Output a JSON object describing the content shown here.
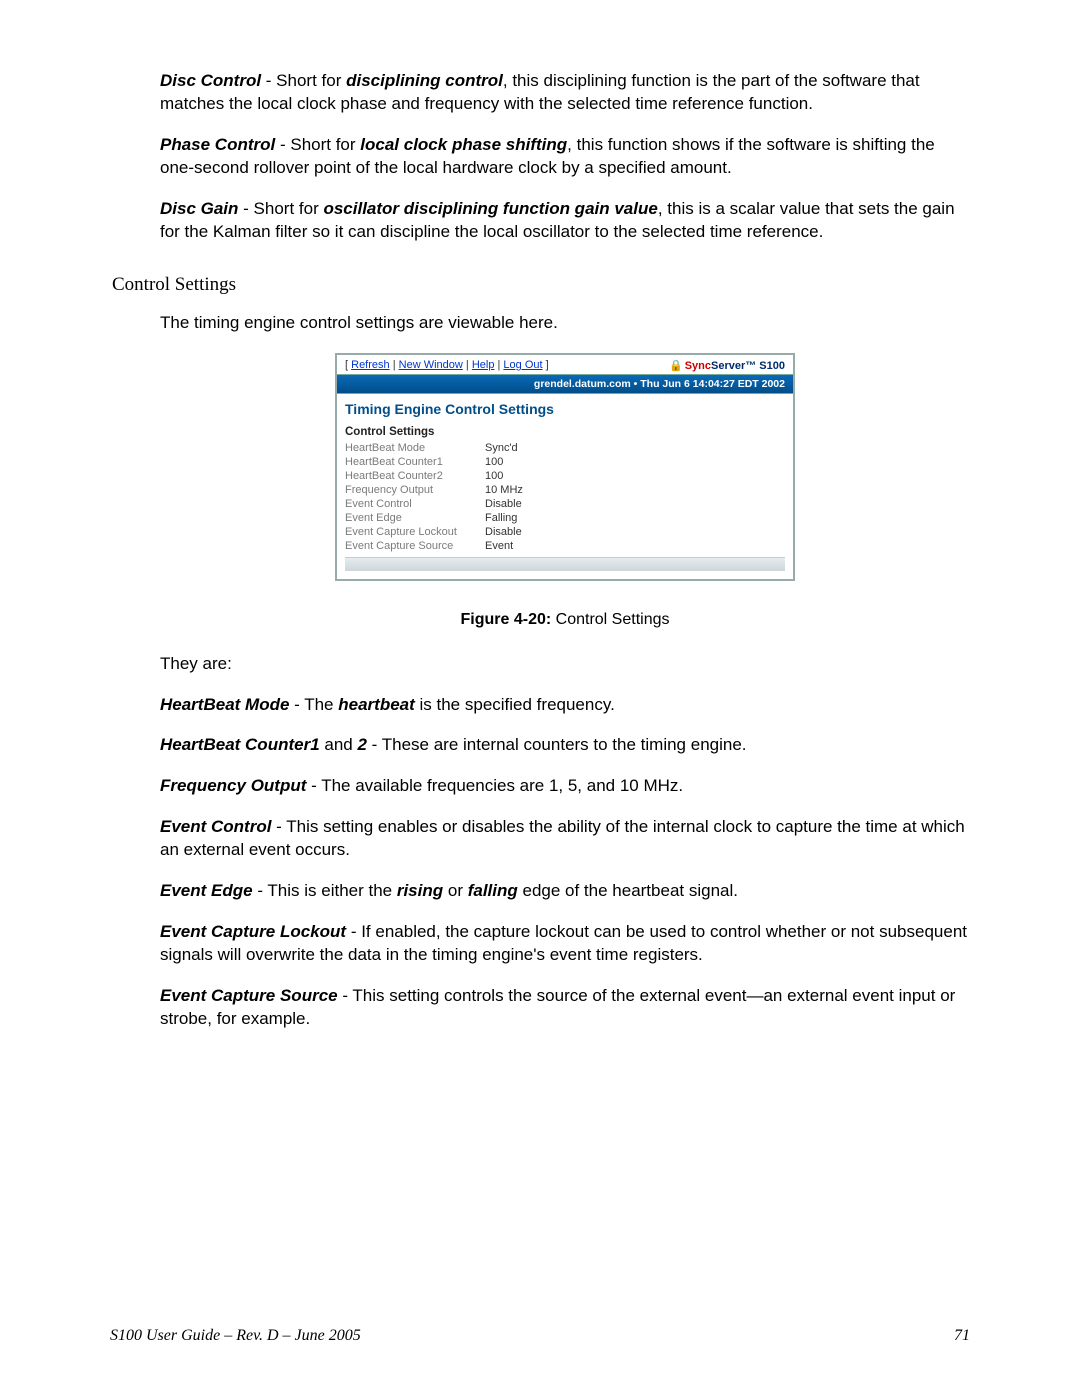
{
  "paragraphs": {
    "discControl": {
      "term": "Disc Control",
      "mid1": " - Short for ",
      "term2": "disciplining control",
      "rest": ", this disciplining function is the part of the software that matches the local clock phase and frequency with the selected time reference function."
    },
    "phaseControl": {
      "term": "Phase Control",
      "mid1": " - Short for ",
      "term2": "local clock phase shifting",
      "rest": ", this function shows if the software is shifting the one-second rollover point of the local hardware clock by a specified amount."
    },
    "discGain": {
      "term": "Disc Gain",
      "mid1": " - Short for ",
      "term2": "oscillator disciplining function gain value",
      "rest": ", this is a scalar value that sets the gain for the Kalman filter so it can discipline the local oscillator to the selected time reference."
    },
    "sectionHeading": "Control Settings",
    "intro": "The timing engine control settings are viewable here.",
    "theyAre": "They are:",
    "hbMode": {
      "term": "HeartBeat Mode",
      "mid": " - The ",
      "term2": "heartbeat",
      "rest": " is the specified frequency."
    },
    "hbCounter": {
      "term": "HeartBeat Counter1",
      "and": " and ",
      "term2": "2",
      "rest": " - These are internal counters to the timing engine."
    },
    "freqOut": {
      "term": "Frequency Output",
      "rest": " - The available frequencies are 1, 5, and 10 MHz."
    },
    "evCtrl": {
      "term": "Event Control",
      "rest": " - This setting enables or disables the ability of the internal clock to capture the time at which an external event occurs."
    },
    "evEdge": {
      "term": "Event Edge",
      "mid": " - This is either the ",
      "term2": "rising",
      "or": " or ",
      "term3": "falling",
      "rest": " edge of the heartbeat signal."
    },
    "evLock": {
      "term": "Event Capture Lockout",
      "rest": " - If enabled, the capture lockout can be used to control whether or not subsequent signals will overwrite the data in the timing engine's event time registers."
    },
    "evSrc": {
      "term": "Event Capture Source",
      "rest": " - This setting controls the source of the external event—an external event input or strobe, for example."
    }
  },
  "figure": {
    "captionLabel": "Figure 4-20:",
    "captionText": "  Control Settings"
  },
  "shot": {
    "crumbs": {
      "open": "[ ",
      "refresh": "Refresh",
      "sep": " | ",
      "newWindow": "New Window",
      "help": "Help",
      "logout": "Log Out",
      "close": " ]"
    },
    "brand": {
      "lock": "🔒",
      "sync": "Sync",
      "server": "Server",
      "tm": "™ S100"
    },
    "status": "grendel.datum.com  •  Thu Jun 6 14:04:27 EDT 2002",
    "panelTitle": "Timing Engine Control Settings",
    "subhead": "Control Settings",
    "rows": [
      {
        "label": "HeartBeat Mode",
        "value": "Sync'd"
      },
      {
        "label": "HeartBeat Counter1",
        "value": "100"
      },
      {
        "label": "HeartBeat Counter2",
        "value": "100"
      },
      {
        "label": "Frequency Output",
        "value": "10 MHz"
      },
      {
        "label": "Event Control",
        "value": "Disable"
      },
      {
        "label": "Event Edge",
        "value": "Falling"
      },
      {
        "label": "Event Capture Lockout",
        "value": "Disable"
      },
      {
        "label": "Event Capture Source",
        "value": "Event"
      }
    ]
  },
  "footer": {
    "left": "S100 User Guide – Rev. D – June 2005",
    "right": "71"
  }
}
